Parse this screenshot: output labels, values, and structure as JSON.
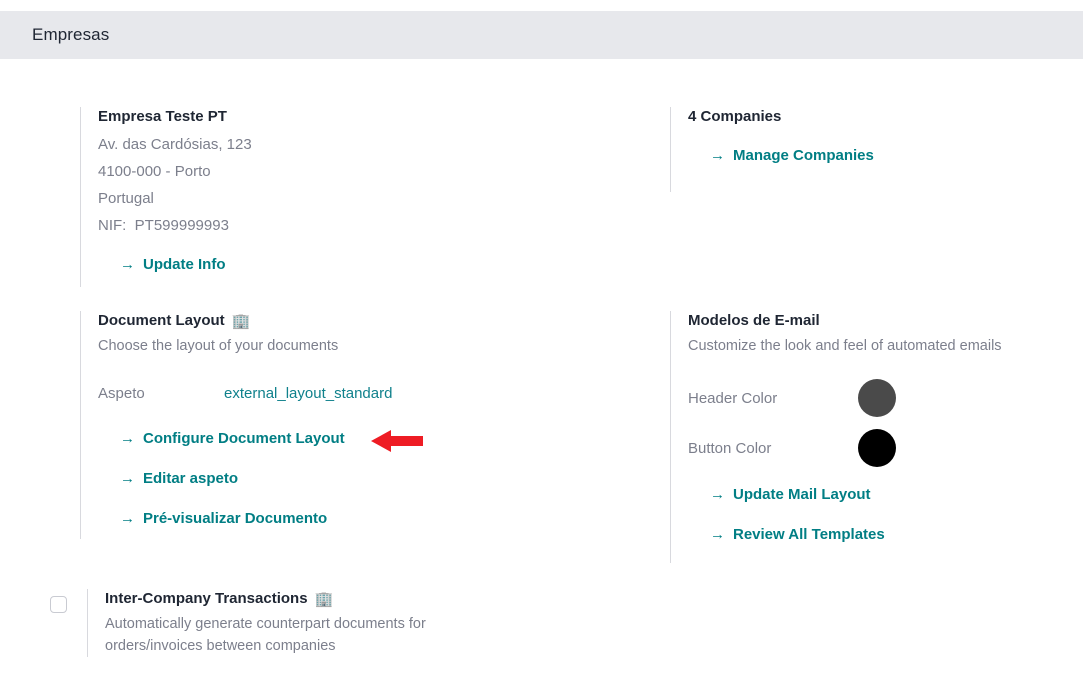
{
  "header": {
    "title": "Empresas"
  },
  "company": {
    "name": "Empresa Teste PT",
    "address": [
      "Av. das Cardósias, 123",
      "4100-000 - Porto",
      "Portugal",
      "NIF:  PT599999993"
    ],
    "update_link": "Update Info",
    "arrow_glyph": "→"
  },
  "companies": {
    "count_label": "4 Companies",
    "manage_link": "Manage Companies"
  },
  "document_layout": {
    "title": "Document Layout",
    "icon": "building-icon",
    "icon_glyph": "🏢",
    "subtitle": "Choose the layout of your documents",
    "field_label": "Aspeto",
    "field_value": "external_layout_standard",
    "links": [
      "Configure Document Layout",
      "Editar aspeto",
      "Pré-visualizar Documento"
    ]
  },
  "email_templates": {
    "title": "Modelos de E-mail",
    "subtitle": "Customize the look and feel of automated emails",
    "header_color_label": "Header Color",
    "header_color_value": "#4a4a4a",
    "button_color_label": "Button Color",
    "button_color_value": "#000000",
    "links": [
      "Update Mail Layout",
      "Review All Templates"
    ]
  },
  "inter_company": {
    "title": "Inter-Company Transactions",
    "icon": "building-icon",
    "icon_glyph": "🏢",
    "checked": false,
    "description": [
      "Automatically generate counterpart documents for",
      "orders/invoices between companies"
    ]
  },
  "annotation": {
    "arrow_color": "#ee1c24",
    "points_to": "Configure Document Layout"
  },
  "theme": {
    "header_bg": "#e7e8ec",
    "link_teal": "#017e84",
    "value_teal": "#10818c",
    "muted_text": "#7c7f8c",
    "heading_text": "#1f2633",
    "divider": "#d8d9de"
  }
}
